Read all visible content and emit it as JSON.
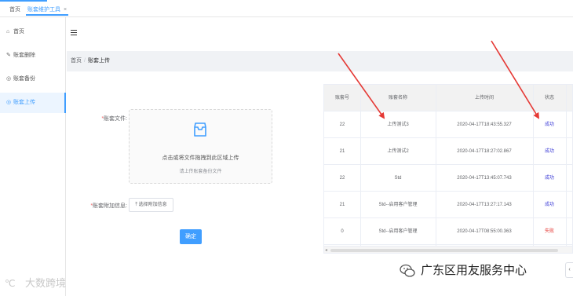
{
  "tabs": {
    "home": "首页",
    "active": "账套维护工具",
    "close": "×"
  },
  "sidebar": {
    "items": [
      {
        "label": "首页",
        "icon": "home-icon"
      },
      {
        "label": "账套删除",
        "icon": "wrench-icon"
      },
      {
        "label": "账套备份",
        "icon": "disk-icon"
      },
      {
        "label": "账套上传",
        "icon": "upload-icon",
        "active": true
      }
    ]
  },
  "breadcrumb": {
    "root": "首页",
    "separator": "/",
    "current": "账套上传"
  },
  "form": {
    "file_label": "账套文件:",
    "upload_text": "点击或将文件拖拽到此区域上传",
    "upload_hint": "请上传账套备份文件",
    "attach_label": "账套附加信息:",
    "attach_button": "选择附加信息",
    "submit_button": "确定"
  },
  "table": {
    "headers": [
      "账套号",
      "账套名称",
      "上传时间",
      "状态"
    ],
    "rows": [
      {
        "id": "22",
        "name": "上传测试3",
        "time": "2020-04-17T18:43:55.327",
        "status": "成功"
      },
      {
        "id": "21",
        "name": "上传测试2",
        "time": "2020-04-17T18:27:02.867",
        "status": "成功"
      },
      {
        "id": "22",
        "name": "Std",
        "time": "2020-04-17T13:45:07.743",
        "status": "成功"
      },
      {
        "id": "21",
        "name": "Std--启用客户管理",
        "time": "2020-04-17T13:27:17.143",
        "status": "成功"
      },
      {
        "id": "0",
        "name": "Std--启用客户管理",
        "time": "2020-04-17T08:55:00.363",
        "status": "失败"
      }
    ]
  },
  "watermarks": {
    "left": "大数跨境",
    "right": "广东区用友服务中心"
  },
  "colors": {
    "accent": "#409eff",
    "status_success": "#3b3bd6",
    "status_fail": "#e53935",
    "annotation_arrow": "#e53935"
  }
}
